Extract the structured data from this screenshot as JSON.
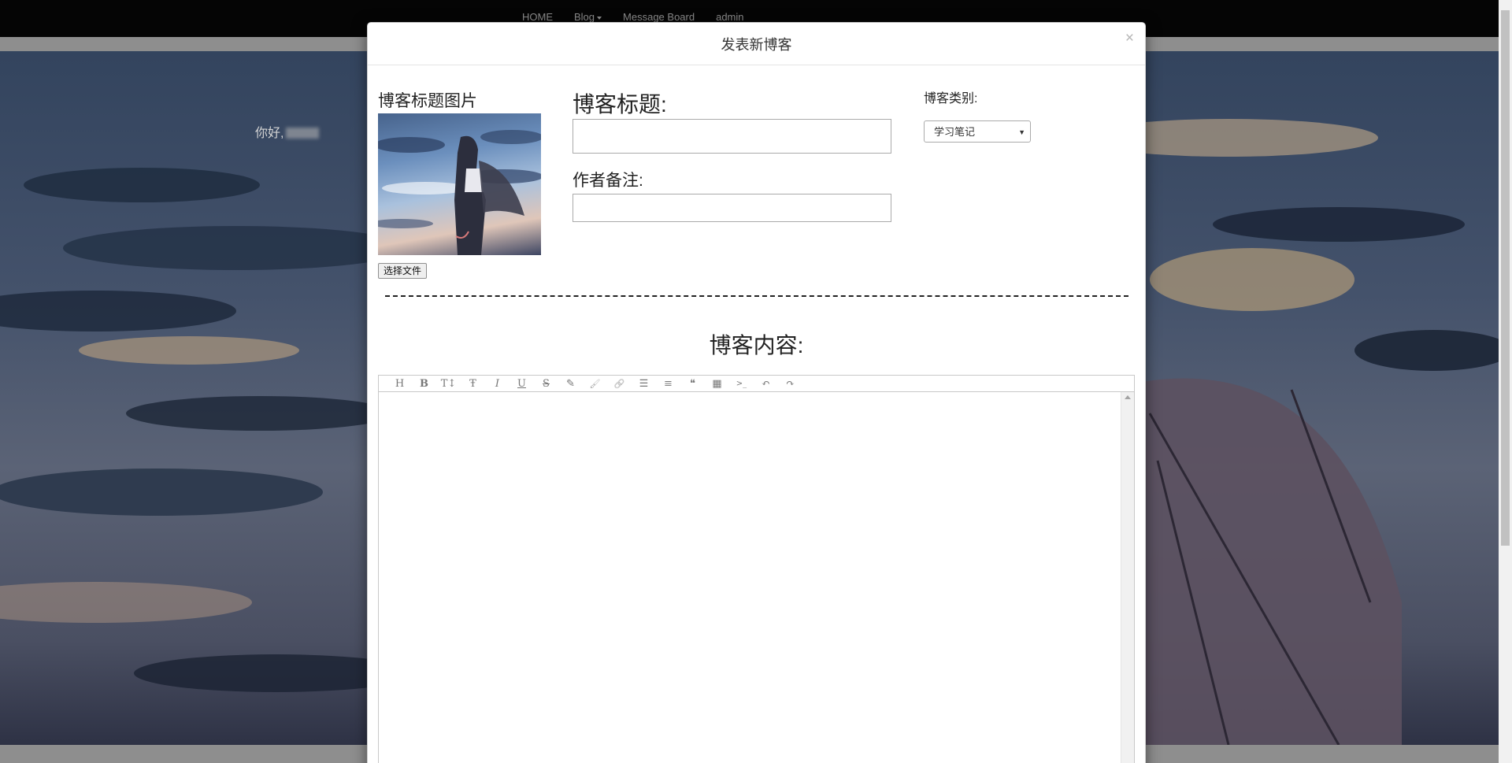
{
  "nav": {
    "items": [
      "HOME",
      "Blog",
      "Message Board",
      "admin"
    ]
  },
  "background": {
    "greeting": "你好,"
  },
  "modal": {
    "title": "发表新博客",
    "close_glyph": "×",
    "image_label": "博客标题图片",
    "choose_file_label": "选择文件",
    "blog_title_label": "博客标题:",
    "blog_title_value": "",
    "author_note_label": "作者备注:",
    "author_note_value": "",
    "category_label": "博客类别:",
    "category_selected": "学习笔记",
    "content_label": "博客内容:",
    "editor_toolbar": [
      {
        "icon": "heading-icon",
        "glyph": "H"
      },
      {
        "icon": "bold-icon",
        "glyph": "B"
      },
      {
        "icon": "font-size-icon",
        "glyph": "T↕"
      },
      {
        "icon": "font-family-icon",
        "glyph": "Ŧ"
      },
      {
        "icon": "italic-icon",
        "glyph": "I"
      },
      {
        "icon": "underline-icon",
        "glyph": "U"
      },
      {
        "icon": "strikethrough-icon",
        "glyph": "S"
      },
      {
        "icon": "pen-icon",
        "glyph": "✎"
      },
      {
        "icon": "brush-icon",
        "glyph": "🖌"
      },
      {
        "icon": "link-icon",
        "glyph": "🔗"
      },
      {
        "icon": "bullet-list-icon",
        "glyph": "☰"
      },
      {
        "icon": "align-icon",
        "glyph": "≡"
      },
      {
        "icon": "quote-icon",
        "glyph": "❝"
      },
      {
        "icon": "table-icon",
        "glyph": "▦"
      },
      {
        "icon": "code-icon",
        "glyph": ">_"
      },
      {
        "icon": "undo-icon",
        "glyph": "↶"
      },
      {
        "icon": "redo-icon",
        "glyph": "↷"
      }
    ]
  },
  "colors": {
    "navbar_bg": "#050505",
    "nav_link": "#8d8d8d",
    "modal_bg": "#ffffff"
  }
}
